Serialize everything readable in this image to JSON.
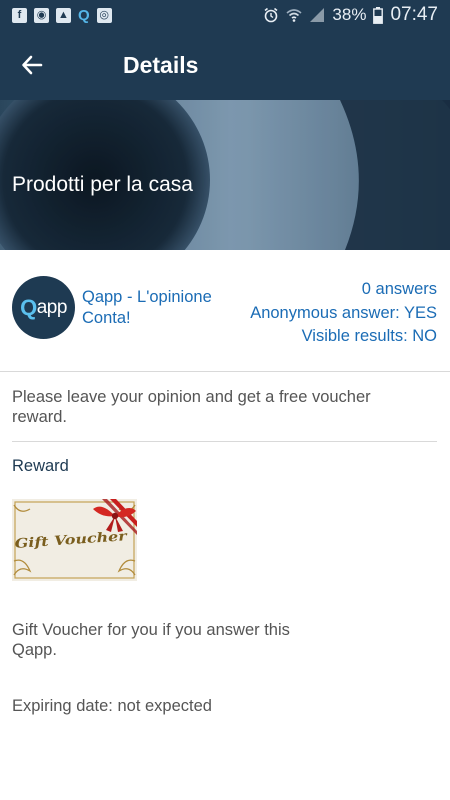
{
  "status_bar": {
    "battery_percent": "38%",
    "time": "07:47",
    "left_icons": [
      "facebook-icon",
      "camera-notification-icon",
      "image-notification-icon",
      "qapp-notification-icon",
      "screenshot-notification-icon"
    ],
    "right_icons": [
      "alarm-icon",
      "wifi-icon",
      "signal-icon",
      "battery-icon"
    ]
  },
  "app_bar": {
    "back_icon": "arrow-left-icon",
    "title": "Details"
  },
  "hero": {
    "title": "Prodotti per la casa"
  },
  "info": {
    "avatar_label_q": "Q",
    "avatar_label_rest": "app",
    "org_link": "Qapp - L'opinione Conta!",
    "answers": "0 answers",
    "anonymous": "Anonymous answer: YES",
    "visible_results": "Visible results: NO"
  },
  "content": {
    "description": "Please leave your opinion and get a free voucher reward.",
    "reward_heading": "Reward",
    "voucher_image_text": "Gift Voucher",
    "voucher_text": "Gift Voucher for you if you answer this Qapp.",
    "expiring": "Expiring date: not expected"
  },
  "colors": {
    "primary": "#1f3a52",
    "link": "#1b6cb5",
    "accent": "#5bc0ee",
    "body_text": "#555555"
  }
}
